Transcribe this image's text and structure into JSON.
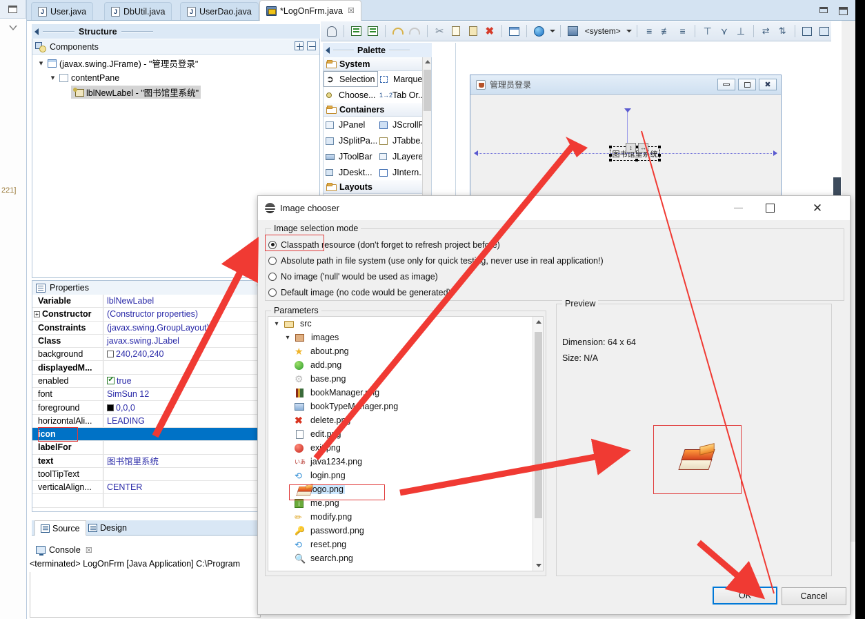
{
  "rail": {
    "marker_text": "221]"
  },
  "tabs": {
    "items": [
      {
        "label": "User.java",
        "icon": "java-file-icon",
        "active": false
      },
      {
        "label": "DbUtil.java",
        "icon": "java-file-icon",
        "active": false
      },
      {
        "label": "UserDao.java",
        "icon": "java-file-icon",
        "active": false
      },
      {
        "label": "*LogOnFrm.java",
        "icon": "windowbuilder-file-icon",
        "active": true,
        "close": "☒"
      }
    ]
  },
  "structure": {
    "title": "Structure",
    "components_label": "Components",
    "expand_all": "expand-all-button",
    "collapse_all": "collapse-all-button",
    "tree": [
      {
        "label": "(javax.swing.JFrame) - \"管理员登录\"",
        "indent": 0,
        "icon": "jframe-icon",
        "selected": false
      },
      {
        "label": "contentPane",
        "indent": 1,
        "icon": "panel-icon",
        "selected": false
      },
      {
        "label": "lblNewLabel - \"图书馆里系统\"",
        "indent": 2,
        "icon": "jlabel-icon",
        "selected": true
      }
    ]
  },
  "properties": {
    "title": "Properties",
    "rows": [
      {
        "name": "Variable",
        "value": "lblNewLabel",
        "bold": true,
        "selected": false
      },
      {
        "name": "Constructor",
        "value": "(Constructor properties)",
        "bold": true,
        "expandable": true,
        "selected": false
      },
      {
        "name": "Constraints",
        "value": "(javax.swing.GroupLayout)",
        "bold": true,
        "selected": false
      },
      {
        "name": "Class",
        "value": "javax.swing.JLabel",
        "bold": true,
        "selected": false
      },
      {
        "name": "background",
        "value": "240,240,240",
        "bold": false,
        "swatch": "white",
        "selected": false
      },
      {
        "name": "displayedM...",
        "value": "",
        "bold": true,
        "selected": false
      },
      {
        "name": "enabled",
        "value": "true",
        "bold": false,
        "check": true,
        "selected": false
      },
      {
        "name": "font",
        "value": "SimSun 12",
        "bold": false,
        "selected": false
      },
      {
        "name": "foreground",
        "value": "0,0,0",
        "bold": false,
        "swatch": "black",
        "selected": false
      },
      {
        "name": "horizontalAli...",
        "value": "LEADING",
        "bold": false,
        "selected": false
      },
      {
        "name": "icon",
        "value": "",
        "bold": true,
        "selected": true
      },
      {
        "name": "labelFor",
        "value": "",
        "bold": true,
        "selected": false
      },
      {
        "name": "text",
        "value": "图书馆里系统",
        "bold": true,
        "selected": false
      },
      {
        "name": "toolTipText",
        "value": "",
        "bold": false,
        "selected": false
      },
      {
        "name": "verticalAlign...",
        "value": "CENTER",
        "bold": false,
        "selected": false
      },
      {
        "name": "",
        "value": "",
        "bold": false,
        "selected": false
      }
    ]
  },
  "source_design": {
    "source_label": "Source",
    "design_label": "Design"
  },
  "console": {
    "tab_label": "Console",
    "close": "☒",
    "line": "<terminated> LogOnFrm [Java Application] C:\\Program "
  },
  "editor_toolbar": {
    "system_label": "<system>",
    "buttons": [
      "test-button",
      "refresh-button",
      "open-source-button",
      "undo-button",
      "redo-button",
      "cut-button",
      "copy-button",
      "paste-button",
      "delete-button",
      "properties-button",
      "locale-button",
      "locale-dropdown",
      "lookandfeel-button",
      "lookandfeel-dropdown",
      "align-left-button",
      "align-center-button",
      "align-right-button",
      "align-top-button",
      "align-middle-button",
      "align-bottom-button",
      "match-width-button",
      "match-height-button",
      "replicate-horizontal-button",
      "replicate-vertical-button"
    ]
  },
  "palette": {
    "title": "Palette",
    "categories": [
      {
        "name": "System",
        "items": [
          {
            "label": "Selection",
            "icon": "cursor-icon",
            "boxed": true
          },
          {
            "label": "Marquee",
            "icon": "marquee-icon",
            "boxed": false
          },
          {
            "label": "Choose...",
            "icon": "choose-component-icon",
            "boxed": false
          },
          {
            "label": "Tab Or...",
            "icon": "tab-order-icon",
            "boxed": false
          }
        ]
      },
      {
        "name": "Containers",
        "items": [
          {
            "label": "JPanel",
            "icon": "jpanel-icon",
            "boxed": false
          },
          {
            "label": "JScrollP...",
            "icon": "jscrollpane-icon",
            "boxed": false
          },
          {
            "label": "JSplitPa...",
            "icon": "jsplitpane-icon",
            "boxed": false
          },
          {
            "label": "JTabbe...",
            "icon": "jtabbedpane-icon",
            "boxed": false
          },
          {
            "label": "JToolBar",
            "icon": "jtoolbar-icon",
            "boxed": false
          },
          {
            "label": "JLayere...",
            "icon": "jlayeredpane-icon",
            "boxed": false
          },
          {
            "label": "JDeskt...",
            "icon": "jdesktoppane-icon",
            "boxed": false
          },
          {
            "label": "JIntern...",
            "icon": "jinternalframe-icon",
            "boxed": false
          }
        ]
      },
      {
        "name": "Layouts",
        "items": []
      }
    ]
  },
  "canvas": {
    "frame_title": "管理员登录",
    "label_text": "图书馆里系统",
    "minimize": "—",
    "maximize": "□",
    "close": "☒"
  },
  "dialog": {
    "title": "Image chooser",
    "minimize": "—",
    "maximize": "□",
    "close": "✕",
    "mode_group_label": "Image selection mode",
    "modes": [
      {
        "label": "Classpath resource (don't forget to refresh project before)",
        "selected": true
      },
      {
        "label": "Absolute path in file system (use only for quick testing, never use in real application!)",
        "selected": false
      },
      {
        "label": "No image ('null' would be used as image)",
        "selected": false
      },
      {
        "label": "Default image (no code would be generated)",
        "selected": false
      }
    ],
    "parameters_label": "Parameters",
    "tree": [
      {
        "label": "src",
        "indent": 0,
        "twisty": "▾",
        "icon": "source-folder-icon",
        "selected": false
      },
      {
        "label": "images",
        "indent": 1,
        "twisty": "▾",
        "icon": "package-icon",
        "selected": false
      },
      {
        "label": "about.png",
        "indent": 2,
        "twisty": "",
        "icon": "star-icon",
        "selected": false
      },
      {
        "label": "add.png",
        "indent": 2,
        "twisty": "",
        "icon": "add-green-icon",
        "selected": false
      },
      {
        "label": "base.png",
        "indent": 2,
        "twisty": "",
        "icon": "gear-icon",
        "selected": false
      },
      {
        "label": "bookManager.png",
        "indent": 2,
        "twisty": "",
        "icon": "books-icon",
        "selected": false
      },
      {
        "label": "bookTypeManager.png",
        "indent": 2,
        "twisty": "",
        "icon": "bookshelf-icon",
        "selected": false
      },
      {
        "label": "delete.png",
        "indent": 2,
        "twisty": "",
        "icon": "delete-x-icon",
        "selected": false
      },
      {
        "label": "edit.png",
        "indent": 2,
        "twisty": "",
        "icon": "edit-pencil-icon",
        "selected": false
      },
      {
        "label": "exit.png",
        "indent": 2,
        "twisty": "",
        "icon": "exit-red-icon",
        "selected": false
      },
      {
        "label": "java1234.png",
        "indent": 2,
        "twisty": "",
        "icon": "java1234-icon",
        "selected": false
      },
      {
        "label": "login.png",
        "indent": 2,
        "twisty": "",
        "icon": "login-arrow-icon",
        "selected": false
      },
      {
        "label": "logo.png",
        "indent": 2,
        "twisty": "",
        "icon": "logo-books-icon",
        "selected": true
      },
      {
        "label": "me.png",
        "indent": 2,
        "twisty": "",
        "icon": "info-icon",
        "selected": false
      },
      {
        "label": "modify.png",
        "indent": 2,
        "twisty": "",
        "icon": "modify-pencil-icon",
        "selected": false
      },
      {
        "label": "password.png",
        "indent": 2,
        "twisty": "",
        "icon": "key-icon",
        "selected": false
      },
      {
        "label": "reset.png",
        "indent": 2,
        "twisty": "",
        "icon": "reset-icon",
        "selected": false
      },
      {
        "label": "search.png",
        "indent": 2,
        "twisty": "",
        "icon": "search-icon",
        "selected": false
      }
    ],
    "preview_label": "Preview",
    "preview_dimension": "Dimension: 64 x 64",
    "preview_size": "Size: N/A",
    "ok_label": "OK",
    "cancel_label": "Cancel"
  },
  "colors": {
    "accent_blue": "#0072c6",
    "annotation_red": "#e03b3b",
    "default_button_border": "#0078d7",
    "selection_gray": "#d4d4d4",
    "tree_selection_blue": "#cde8ff"
  }
}
